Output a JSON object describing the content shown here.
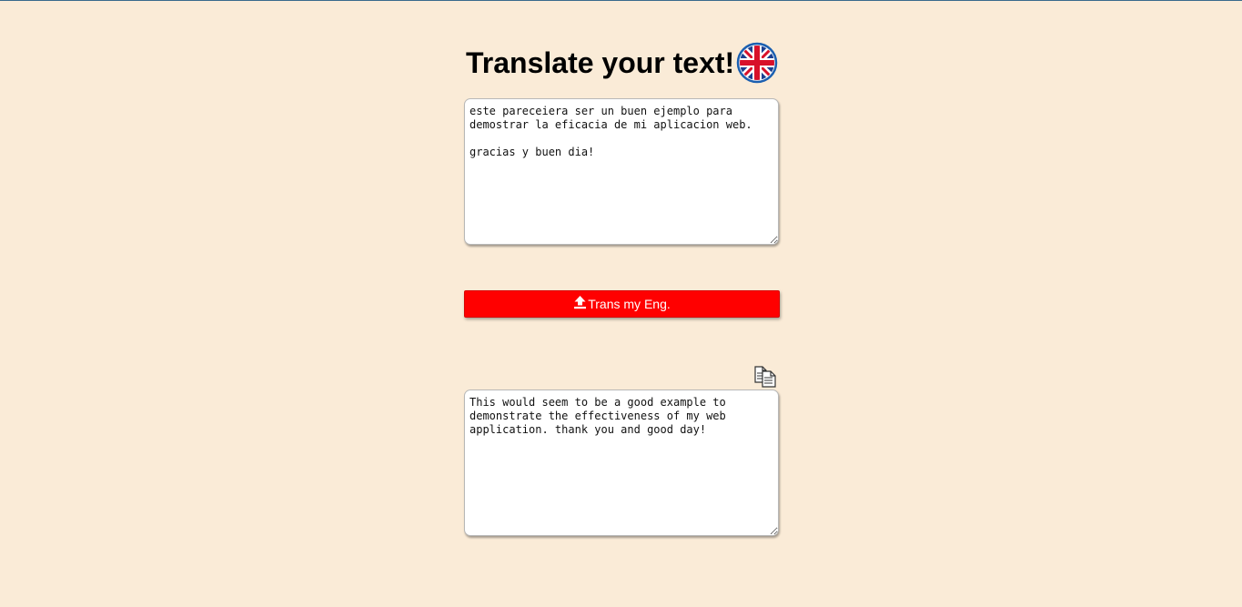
{
  "header": {
    "title": "Translate your text!",
    "flag_icon": "uk-flag-icon"
  },
  "source": {
    "value": "este pareceiera ser un buen ejemplo para\ndemostrar la eficacia de mi aplicacion web.\n\ngracias y buen dia!"
  },
  "translate_button": {
    "label": "Trans my Eng.",
    "icon": "upload-icon",
    "color": "#ff0000"
  },
  "copy_icon": "copy-document-icon",
  "result": {
    "value": "This would seem to be a good example to\ndemonstrate the effectiveness of my web\napplication. thank you and good day!"
  },
  "theme": {
    "background": "#faebd7",
    "button_color": "#ff0000",
    "button_text": "#ffffff"
  }
}
